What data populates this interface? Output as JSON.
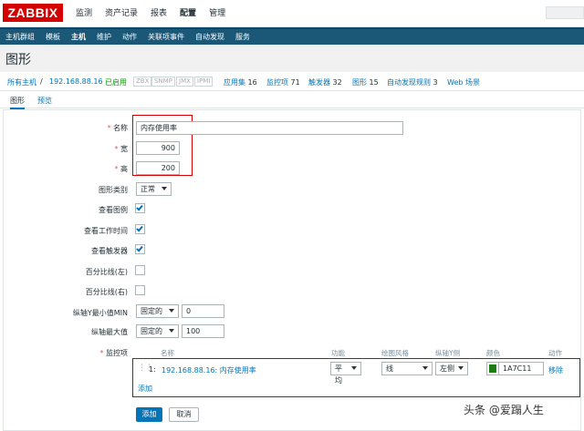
{
  "logo": "ZABBIX",
  "main_menu": [
    {
      "label": "监测",
      "active": false
    },
    {
      "label": "资产记录",
      "active": false
    },
    {
      "label": "报表",
      "active": false
    },
    {
      "label": "配置",
      "active": true
    },
    {
      "label": "管理",
      "active": false
    }
  ],
  "sub_menu": [
    {
      "label": "主机群组",
      "active": false
    },
    {
      "label": "模板",
      "active": false
    },
    {
      "label": "主机",
      "active": true
    },
    {
      "label": "维护",
      "active": false
    },
    {
      "label": "动作",
      "active": false
    },
    {
      "label": "关联项事件",
      "active": false
    },
    {
      "label": "自动发现",
      "active": false
    },
    {
      "label": "服务",
      "active": false
    }
  ],
  "page_title": "图形",
  "breadcrumb": {
    "all_hosts": "所有主机",
    "separator": "/",
    "host": "192.168.88.16",
    "status": "已启用",
    "badges": [
      "ZBX",
      "SNMP",
      "JMX",
      "IPMI"
    ],
    "items": [
      {
        "label": "应用集",
        "count": "16"
      },
      {
        "label": "监控项",
        "count": "71"
      },
      {
        "label": "触发器",
        "count": "32"
      },
      {
        "label": "图形",
        "count": "15"
      },
      {
        "label": "自动发现规则",
        "count": "3"
      },
      {
        "label": "Web 场景",
        "count": ""
      }
    ]
  },
  "tabs": [
    {
      "label": "图形",
      "active": true
    },
    {
      "label": "预览",
      "active": false
    }
  ],
  "form": {
    "name_label": "名称",
    "name_value": "内存使用率",
    "width_label": "宽",
    "width_value": "900",
    "height_label": "高",
    "height_value": "200",
    "graph_type_label": "图形类别",
    "graph_type_value": "正常",
    "show_legend_label": "查看图例",
    "show_legend": true,
    "show_work_period_label": "查看工作时间",
    "show_work_period": true,
    "show_triggers_label": "查看触发器",
    "show_triggers": true,
    "percentile_left_label": "百分比线(左)",
    "percentile_left": false,
    "percentile_right_label": "百分比线(右)",
    "percentile_right": false,
    "ymin_label": "纵轴Y最小值MIN",
    "ymin_type": "固定的",
    "ymin_value": "0",
    "ymax_label": "纵轴最大值",
    "ymax_type": "固定的",
    "ymax_value": "100",
    "items_label": "监控项",
    "items_table": {
      "headers": [
        "名称",
        "功能",
        "绘图风格",
        "纵轴Y侧",
        "颜色",
        "动作"
      ],
      "rows": [
        {
          "index": "1:",
          "name": "192.168.88.16: 内存使用率",
          "function": "平均",
          "draw_style": "线",
          "y_axis_side": "左侧",
          "color": "1A7C11",
          "action": "移除"
        }
      ],
      "add_link": "添加"
    },
    "add_button": "添加",
    "cancel_button": "取消"
  },
  "colors": {
    "brand": "#d40000",
    "nav": "#1b5878",
    "link": "#0275b8",
    "status_green": "#009900",
    "item_color": "#1A7C11"
  },
  "watermark": "头条 @爱蹋人生"
}
